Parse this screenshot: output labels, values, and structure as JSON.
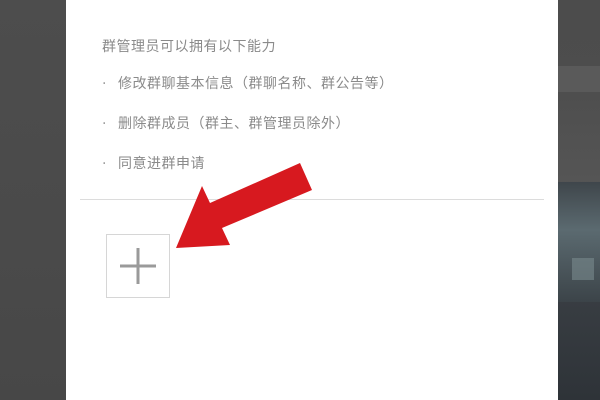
{
  "permissions": {
    "title": "群管理员可以拥有以下能力",
    "bullet": "·",
    "items": [
      {
        "label": "修改群聊基本信息（群聊名称、群公告等）"
      },
      {
        "label": "删除群成员（群主、群管理员除外）"
      },
      {
        "label": "同意进群申请"
      }
    ]
  },
  "add_member": {
    "icon": "plus-icon"
  },
  "annotation": {
    "icon": "arrow-icon",
    "color": "#d7191f"
  },
  "colors": {
    "panel": "#ffffff",
    "text_muted": "#8a8a8a",
    "divider": "#dcdcdc",
    "overlay": "#4a4a4a"
  }
}
